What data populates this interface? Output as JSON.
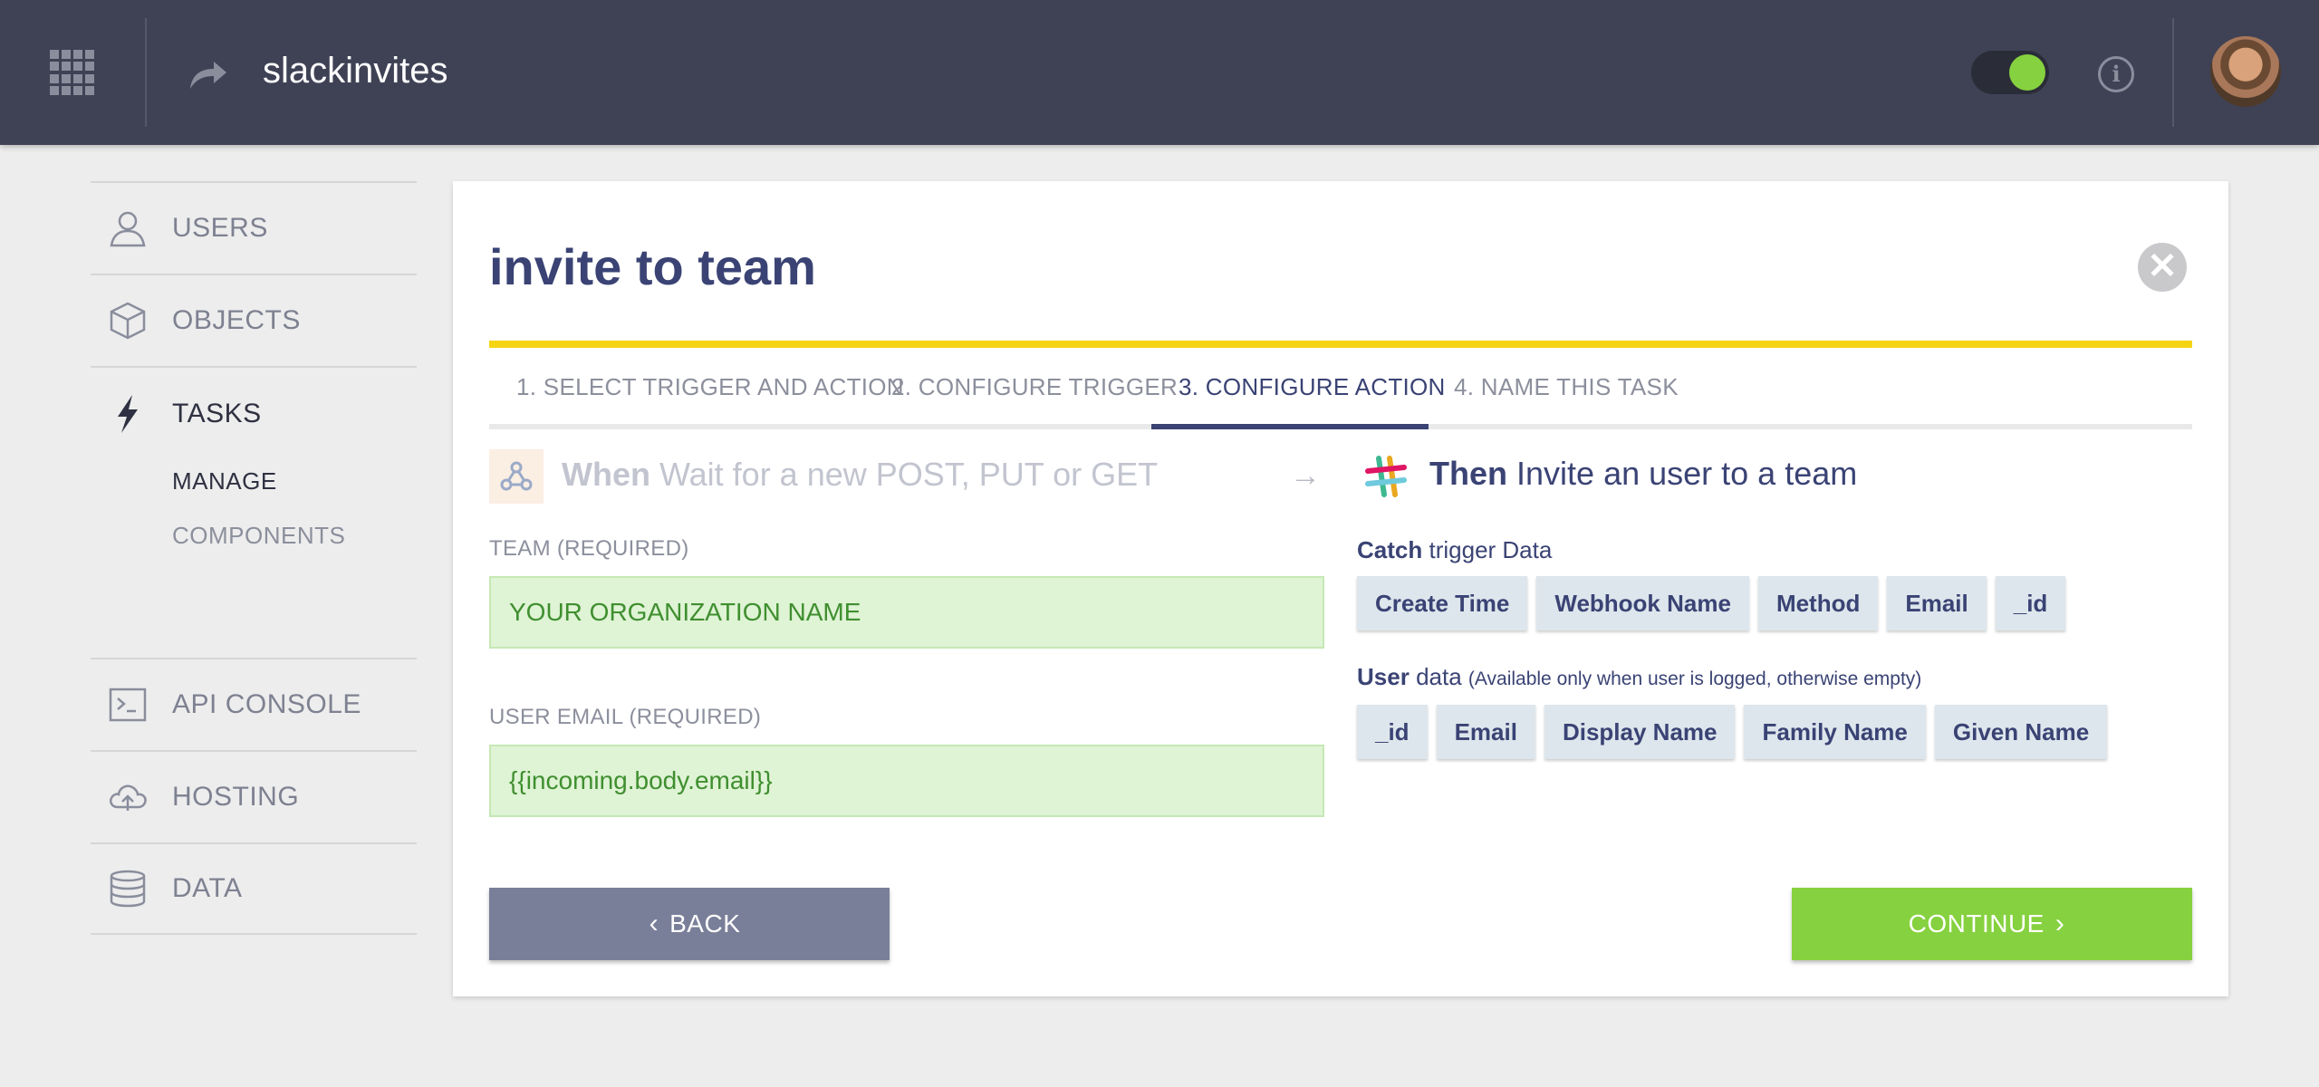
{
  "header": {
    "app_title": "slackinvites",
    "toggle_on": true,
    "toggle_color": "#86d13f",
    "info_icon": "i"
  },
  "sidebar": {
    "items": [
      {
        "label": "USERS",
        "icon": "user-icon"
      },
      {
        "label": "OBJECTS",
        "icon": "cube-icon"
      },
      {
        "label": "TASKS",
        "icon": "lightning-icon"
      },
      {
        "label": "API CONSOLE",
        "icon": "terminal-icon"
      },
      {
        "label": "HOSTING",
        "icon": "cloud-upload-icon"
      },
      {
        "label": "DATA",
        "icon": "database-icon"
      }
    ],
    "sub_items": [
      "MANAGE",
      "COMPONENTS"
    ]
  },
  "card": {
    "title": "invite to team",
    "close_icon": "✕",
    "steps": [
      "1. SELECT TRIGGER AND ACTION",
      "2. CONFIGURE TRIGGER",
      "3. CONFIGURE ACTION",
      "4. NAME THIS TASK"
    ],
    "active_step_index": 2,
    "when": {
      "keyword": "When",
      "text": "Wait for a new POST, PUT or GET"
    },
    "then": {
      "keyword": "Then",
      "text": "Invite an user to a team"
    },
    "fields": {
      "team_label": "TEAM (REQUIRED)",
      "team_value": "YOUR ORGANIZATION NAME",
      "email_label": "USER EMAIL (REQUIRED)",
      "email_value": "{{incoming.body.email}}"
    },
    "catch": {
      "keyword": "Catch",
      "text": "trigger Data",
      "chips": [
        "Create Time",
        "Webhook Name",
        "Method",
        "Email",
        "_id"
      ]
    },
    "user": {
      "keyword": "User",
      "text": "data",
      "note": "(Available only when user is logged, otherwise empty)",
      "chips": [
        "_id",
        "Email",
        "Display Name",
        "Family Name",
        "Given Name"
      ]
    },
    "back_label": "BACK",
    "continue_label": "CONTINUE",
    "colors": {
      "accent": "#3a4374",
      "progress": "#f5d414",
      "continue": "#86d13f",
      "back": "#7a7f99"
    }
  }
}
